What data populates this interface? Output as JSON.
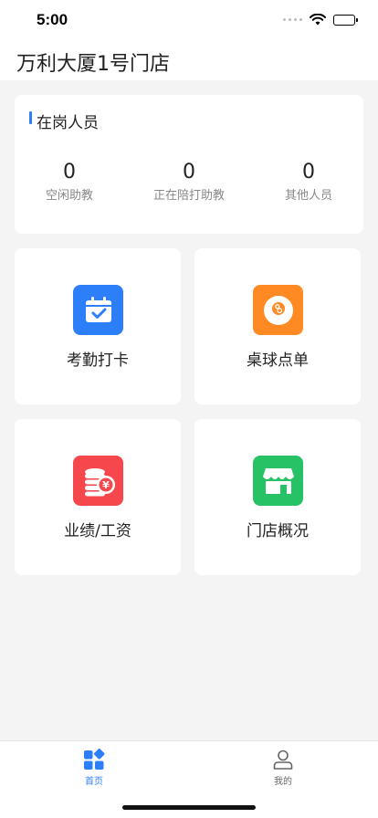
{
  "status_bar": {
    "time": "5:00"
  },
  "header": {
    "title": "万利大厦1号门店"
  },
  "staff": {
    "title": "在岗人员",
    "stats": [
      {
        "value": "0",
        "label": "空闲助教"
      },
      {
        "value": "0",
        "label": "正在陪打助教"
      },
      {
        "value": "0",
        "label": "其他人员"
      }
    ]
  },
  "tiles": [
    {
      "label": "考勤打卡",
      "icon": "calendar-check-icon",
      "color": "#2d7ff9"
    },
    {
      "label": "桌球点单",
      "icon": "billiard-ball-icon",
      "color": "#ff8a24"
    },
    {
      "label": "业绩/工资",
      "icon": "coins-yen-icon",
      "color": "#f5474c"
    },
    {
      "label": "门店概况",
      "icon": "storefront-icon",
      "color": "#27c266"
    }
  ],
  "tab_bar": {
    "tabs": [
      {
        "label": "首页",
        "icon": "grid-icon",
        "active": true
      },
      {
        "label": "我的",
        "icon": "user-icon",
        "active": false
      }
    ],
    "active_color": "#2d7ff9",
    "inactive_color": "#666666"
  }
}
